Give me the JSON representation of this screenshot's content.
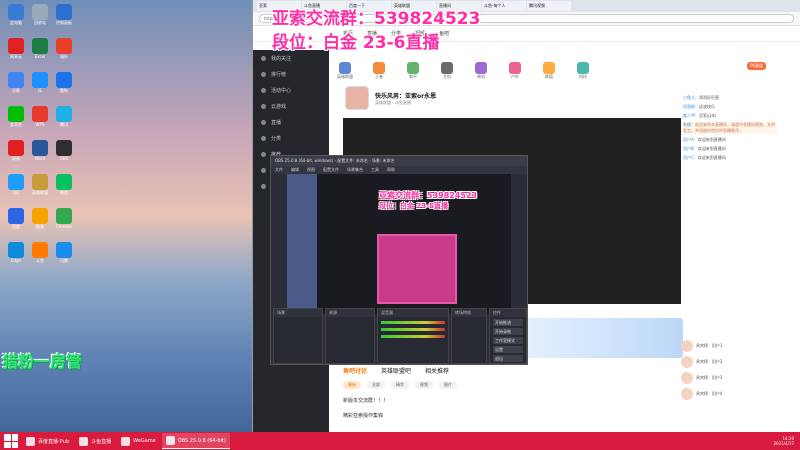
{
  "overlay": {
    "line1": "亚索交流群：539824523",
    "line2": "段位：白金 23-6直播",
    "obs_line1": "亚索交流群：539824523",
    "obs_line2": "段位：白金 23-6直播",
    "side_text": "猎粉一房管"
  },
  "desktop_icons": [
    {
      "label": "此电脑",
      "color": "#3a7bd5"
    },
    {
      "label": "回收站",
      "color": "#9ab"
    },
    {
      "label": "控制面板",
      "color": "#2f6fd0"
    },
    {
      "label": "网易云",
      "color": "#d22"
    },
    {
      "label": "Excel",
      "color": "#1d7b43"
    },
    {
      "label": "福昕",
      "color": "#e8402a"
    },
    {
      "label": "谷歌",
      "color": "#4285f4"
    },
    {
      "label": "IE",
      "color": "#1e90ff"
    },
    {
      "label": "酷狗",
      "color": "#1a73e8"
    },
    {
      "label": "爱奇艺",
      "color": "#00be06"
    },
    {
      "label": "WPS",
      "color": "#e63b2e"
    },
    {
      "label": "腾讯",
      "color": "#1fb0e8"
    },
    {
      "label": "网易",
      "color": "#e02020"
    },
    {
      "label": "Word",
      "color": "#2b579a"
    },
    {
      "label": "OBS",
      "color": "#302e31"
    },
    {
      "label": "QQ",
      "color": "#1e9fff"
    },
    {
      "label": "英雄联盟",
      "color": "#c89b3c"
    },
    {
      "label": "微信",
      "color": "#07c160"
    },
    {
      "label": "百度",
      "color": "#2e65e8"
    },
    {
      "label": "酷我",
      "color": "#f4a300"
    },
    {
      "label": "Chrome",
      "color": "#34a853"
    },
    {
      "label": "Edge",
      "color": "#0c8be0"
    },
    {
      "label": "斗鱼",
      "color": "#ff7a00"
    },
    {
      "label": "迅雷",
      "color": "#1c8dec"
    }
  ],
  "browser": {
    "tabs": [
      "亚索",
      "斗鱼直播",
      "百度一下",
      "英雄联盟",
      "直播间",
      "斗鱼-每个人",
      "腾讯视频"
    ],
    "address": "https://www.douyu.com/",
    "nav": [
      "首页",
      "直播",
      "分类",
      "视频",
      "鱼吧"
    ]
  },
  "left_rail": [
    "我的关注",
    "排行榜",
    "活动中心",
    "云游戏",
    "直播",
    "分类",
    "推荐",
    "游戏",
    "娱乐"
  ],
  "categories": [
    {
      "label": "英雄联盟",
      "color": "#5b87d6"
    },
    {
      "label": "王者",
      "color": "#f58b3a"
    },
    {
      "label": "和平",
      "color": "#64b36a"
    },
    {
      "label": "主机",
      "color": "#6b6b6b"
    },
    {
      "label": "单机",
      "color": "#9c6ad6"
    },
    {
      "label": "户外",
      "color": "#f06292"
    },
    {
      "label": "颜值",
      "color": "#ffab40"
    },
    {
      "label": "科技",
      "color": "#4db6ac"
    }
  ],
  "room": {
    "title": "快乐风男：亚索or永恩",
    "subtitle": "英雄联盟 · 斗鱼直播",
    "count": "12"
  },
  "obs": {
    "title": "OBS 25.0.8 (64-bit, windows) - 配置文件: 未命名 - 场景: 未命名",
    "menu": [
      "文件",
      "编辑",
      "视图",
      "配置文件",
      "场景集合",
      "工具",
      "帮助"
    ],
    "panels": [
      "场景",
      "来源",
      "混音器",
      "转场特效",
      "控件"
    ],
    "controls": [
      "开始推流",
      "开始录制",
      "工作室模式",
      "设置",
      "退出"
    ]
  },
  "discussion": {
    "tabs": [
      "鱼吧讨论",
      "英雄联盟吧",
      "相关推荐"
    ],
    "chips": [
      "最新",
      "全部",
      "精华",
      "视频",
      "图片"
    ],
    "post": "新版本交流群！！！",
    "post2": "精彩亚索操作集锦"
  },
  "chat": {
    "gift": "PK赛道",
    "lines": [
      {
        "name": "小鱼儿：",
        "text": "哥哥好厉害"
      },
      {
        "name": "风男粉：",
        "text": "这波快乐"
      },
      {
        "name": "路人甲：",
        "text": "亚索yyds"
      },
      {
        "name": "系统：",
        "text": "欢迎来到本直播间，请遵守直播间规则，文明发言，共同维护良好的直播秩序。"
      },
      {
        "name": "用户A：",
        "text": "欢迎来到直播间"
      },
      {
        "name": "用户B：",
        "text": "欢迎来到直播间"
      },
      {
        "name": "用户C：",
        "text": "欢迎来到直播间"
      }
    ]
  },
  "fans": [
    {
      "name": "贵宾榜 · 用户1"
    },
    {
      "name": "贵宾榜 · 用户2"
    },
    {
      "name": "贵宾榜 · 用户3"
    },
    {
      "name": "贵宾榜 · 用户4"
    }
  ],
  "taskbar": {
    "buttons": [
      "百度直播-Pub",
      "斗鱼直播",
      "WeGame",
      "OBS 25.0.8 (64-bit)"
    ],
    "time": "14:29",
    "date": "2021/4/17"
  },
  "accent": {
    "taskbar": "#d81b3e",
    "overlay": "#ff2fa8",
    "brand": "#ff7a00"
  }
}
